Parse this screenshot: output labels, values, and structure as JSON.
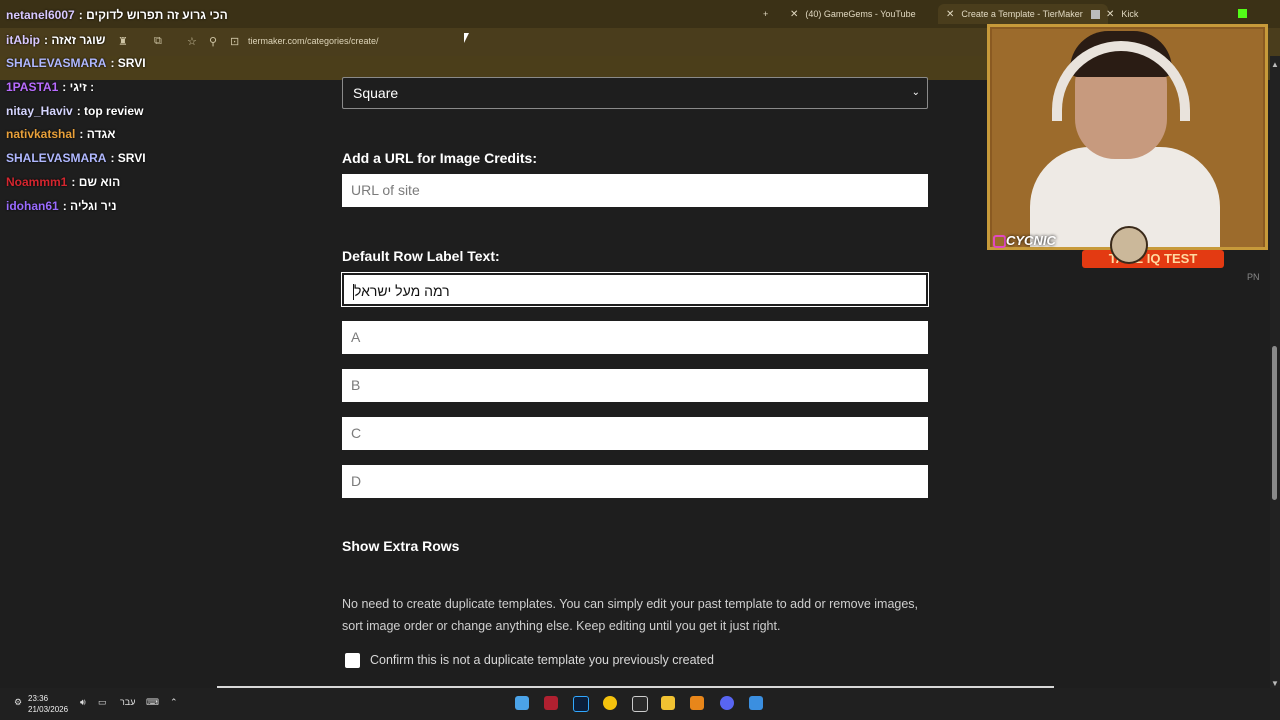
{
  "browser": {
    "tabs": [
      {
        "label": "(40) GameGems - YouTube",
        "active": false
      },
      {
        "label": "Create a Template - TierMaker",
        "active": true
      },
      {
        "label": "Kick",
        "active": false
      }
    ],
    "new_tab_label": "+",
    "close_tab_label": "✕",
    "url": "tiermaker.com/categories/create/"
  },
  "form": {
    "shape_select_value": "Square",
    "image_credits_label": "Add a URL for Image Credits:",
    "image_credits_placeholder": "URL of site",
    "default_row_label": "Default Row Label Text:",
    "default_row_value": "רמה מעל ישראל",
    "rows": [
      "A",
      "B",
      "C",
      "D"
    ],
    "extra_rows_title": "Show Extra Rows",
    "duplicate_note": "No need to create duplicate templates. You can simply edit your past template to add or remove images, sort image order or change anything else. Keep editing until you get it just right.",
    "confirm_label": "Confirm this is not a duplicate template you previously created"
  },
  "chat": [
    {
      "user": "netanel6007",
      "user_color": "#d8c8ff",
      "message": "הכי גרוע זה תפרוש לדוקים"
    },
    {
      "user": "itAbip",
      "user_color": "#d8c8ff",
      "message": "שוגר זאזה"
    },
    {
      "user": "SHALEVASMARA",
      "user_color": "#b0b8ff",
      "message": "SRVI"
    },
    {
      "user": "1PASTA1",
      "user_color": "#b86cff",
      "message": "זיגי :"
    },
    {
      "user": "nitay_Haviv",
      "user_color": "#d6d6ff",
      "message": "top review"
    },
    {
      "user": "nativkatshal",
      "user_color": "#e8a03a",
      "message": "אגדה"
    },
    {
      "user": "SHALEVASMARA",
      "user_color": "#b0b8ff",
      "message": "SRVI"
    },
    {
      "user": "Noammm1",
      "user_color": "#d4262f",
      "message": "הוא שם"
    },
    {
      "user": "idohan61",
      "user_color": "#9a6bff",
      "message": "ניר וגליה"
    }
  ],
  "overlay": {
    "streamer_name": "CYCNIC",
    "promo_text": "TAKE IQ TEST",
    "corner_text": "PN"
  },
  "taskbar": {
    "time": "23:36",
    "date": "21/03/2026",
    "language": "עבר"
  }
}
